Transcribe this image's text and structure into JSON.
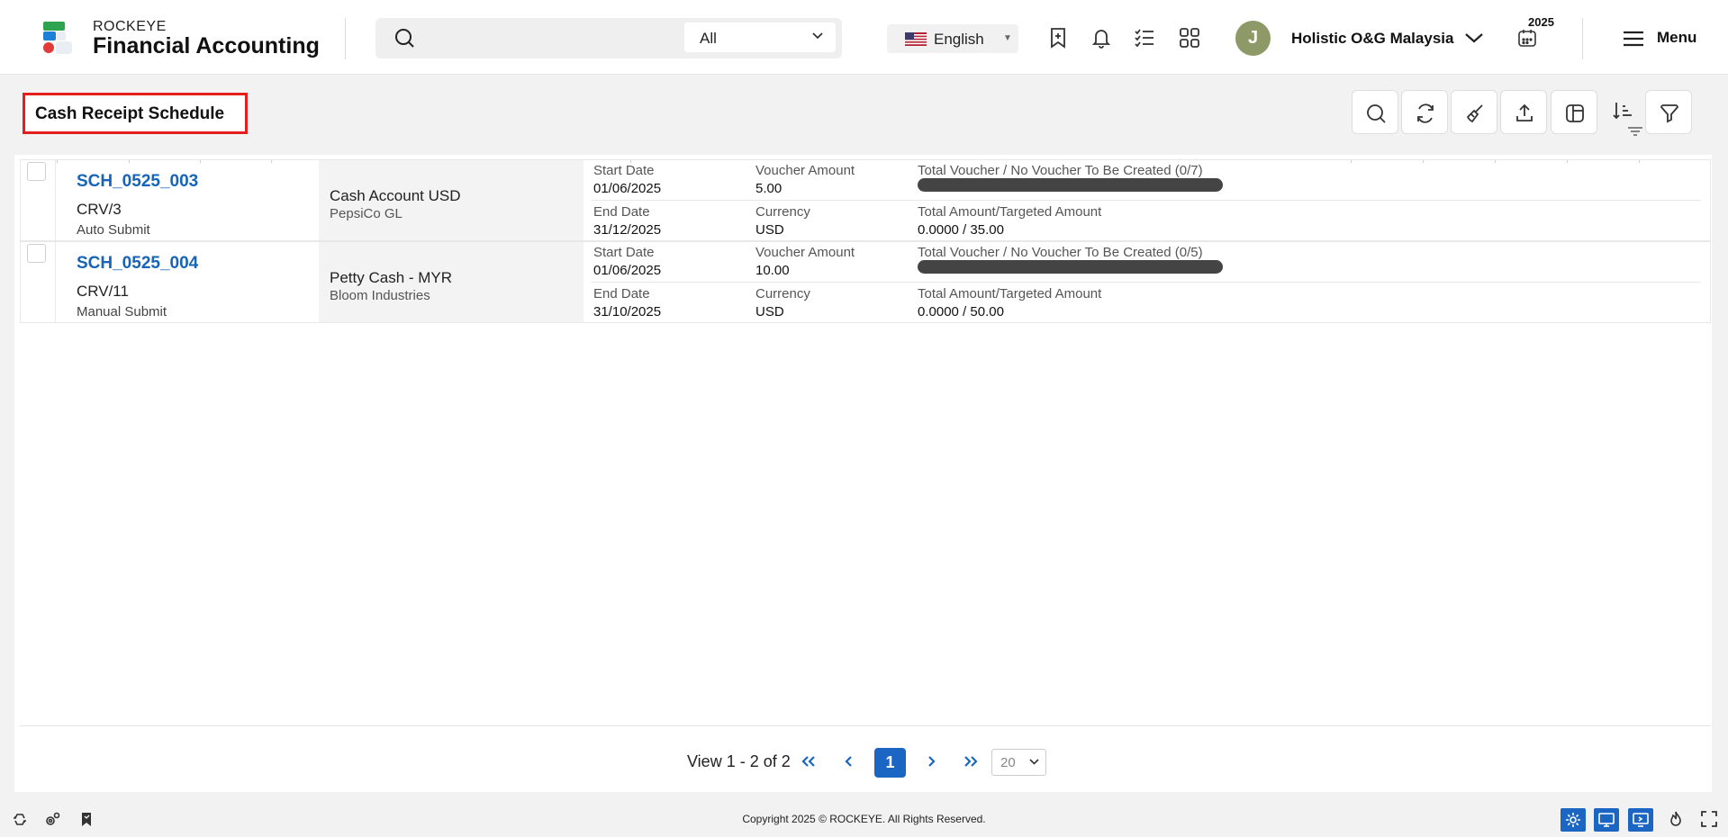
{
  "header": {
    "brand_top": "ROCKEYE",
    "brand_main": "Financial Accounting",
    "search_scope": "All",
    "language": "English",
    "user_initial": "J",
    "company": "Holistic O&G Malaysia",
    "year": "2025",
    "menu_label": "Menu"
  },
  "page": {
    "title": "Cash Receipt Schedule"
  },
  "rows": [
    {
      "code": "SCH_0525_003",
      "ref": "CRV/3",
      "mode": "Auto Submit",
      "account": "Cash Account USD",
      "party": "PepsiCo GL",
      "start_label": "Start Date",
      "start_date": "01/06/2025",
      "end_label": "End Date",
      "end_date": "31/12/2025",
      "amount_label": "Voucher Amount",
      "amount": "5.00",
      "currency_label": "Currency",
      "currency": "USD",
      "voucher_label": "Total Voucher / No Voucher To Be Created (0/7)",
      "total_label": "Total Amount/Targeted Amount",
      "total": "0.0000 / 35.00",
      "progress": 0
    },
    {
      "code": "SCH_0525_004",
      "ref": "CRV/11",
      "mode": "Manual Submit",
      "account": "Petty Cash - MYR",
      "party": "Bloom Industries",
      "start_label": "Start Date",
      "start_date": "01/06/2025",
      "end_label": "End Date",
      "end_date": "31/10/2025",
      "amount_label": "Voucher Amount",
      "amount": "10.00",
      "currency_label": "Currency",
      "currency": "USD",
      "voucher_label": "Total Voucher / No Voucher To Be Created (0/5)",
      "total_label": "Total Amount/Targeted Amount",
      "total": "0.0000 / 50.00",
      "progress": 0
    }
  ],
  "pager": {
    "view_text": "View 1 - 2 of 2",
    "current_page": "1",
    "page_size": "20"
  },
  "footer": {
    "copyright": "Copyright 2025 © ROCKEYE. All Rights Reserved."
  },
  "colors": {
    "accent": "#1a66c2",
    "title_border": "#e41d1d",
    "avatar": "#8d9a67",
    "progress_bar": "#444444"
  }
}
